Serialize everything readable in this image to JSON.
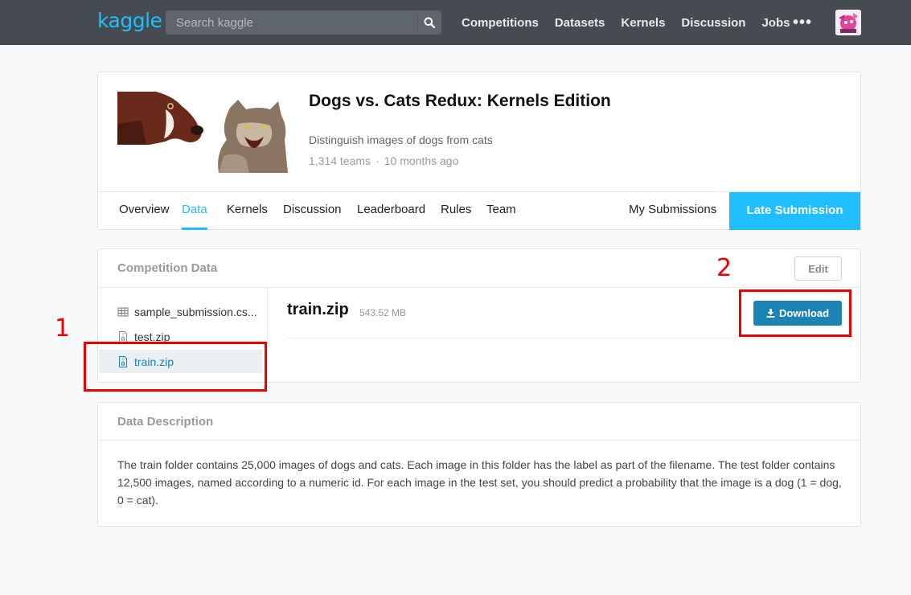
{
  "topbar": {
    "logo": "kaggle",
    "search_placeholder": "Search kaggle",
    "nav": [
      "Competitions",
      "Datasets",
      "Kernels",
      "Discussion",
      "Jobs"
    ],
    "more": "•••"
  },
  "competition": {
    "title": "Dogs vs. Cats Redux: Kernels Edition",
    "subtitle": "Distinguish images of dogs from cats",
    "teams": "1,314 teams",
    "separator": "·",
    "age": "10 months ago"
  },
  "tabs": {
    "items": [
      "Overview",
      "Data",
      "Kernels",
      "Discussion",
      "Leaderboard",
      "Rules",
      "Team"
    ],
    "active": "Data",
    "my_submissions": "My Submissions",
    "late_submission": "Late Submission"
  },
  "data": {
    "section_title": "Competition Data",
    "edit": "Edit",
    "files": [
      "sample_submission.cs...",
      "test.zip",
      "train.zip"
    ],
    "selected_file": "train.zip",
    "selected_name": "train.zip",
    "selected_size": "543.52 MB",
    "download": "Download"
  },
  "description": {
    "title": "Data Description",
    "text": "The train folder contains 25,000 images of dogs and cats. Each image in this folder has the label as part of the filename. The test folder contains 12,500 images, named according to a numeric id. For each image in the test set, you should predict a probability that the image is a dog (1 = dog, 0 = cat)."
  },
  "annotations": {
    "label_1": "1",
    "label_2": "2",
    "color": "#e00000"
  },
  "colors": {
    "accent": "#20beff",
    "download": "#1b84b4",
    "topbar": "#464b52"
  }
}
